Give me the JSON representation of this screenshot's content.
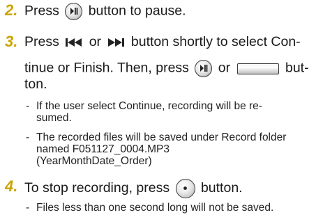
{
  "steps": [
    {
      "num": "2.",
      "line1_pre": "Press",
      "line1_post": "button to pause."
    },
    {
      "num": "3.",
      "line1_pre": "Press",
      "line1_mid": "or",
      "line1_post": "button shortly to select Con-",
      "line2_pre": "tinue or Finish. Then, press",
      "line2_mid": "or",
      "line2_post": "but-",
      "line3": "ton.",
      "notes": [
        {
          "lines": [
            "If the user select Continue, recording will be re-",
            "sumed."
          ]
        },
        {
          "lines": [
            "The recorded files will be saved under Record folder",
            "named F051127_0004.MP3",
            "(YearMonthDate_Order)"
          ]
        }
      ]
    },
    {
      "num": "4.",
      "line1_pre": "To stop recording, press",
      "line1_post": "button.",
      "notes": [
        {
          "lines": [
            "Files less than one second long will not be saved."
          ]
        }
      ]
    }
  ],
  "dash": "-",
  "icons": [
    "play-pause-icon",
    "skip-back-icon",
    "skip-forward-icon",
    "record-bar-icon",
    "stop-dot-icon"
  ],
  "colors": {
    "step_number": "#c9a400",
    "text": "#1a1a1a"
  }
}
